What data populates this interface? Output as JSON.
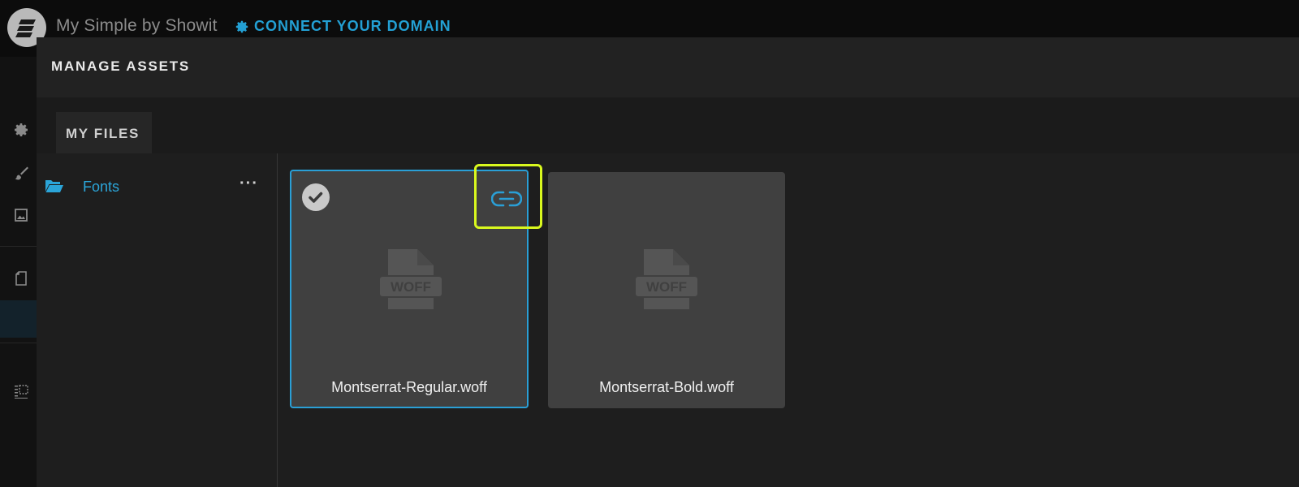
{
  "app": {
    "site_title": "My Simple by Showit",
    "connect_label": "CONNECT YOUR DOMAIN"
  },
  "modal": {
    "title": "MANAGE ASSETS",
    "tabs": [
      {
        "label": "MY FILES"
      }
    ]
  },
  "sidebar": {
    "folders": [
      {
        "label": "Fonts",
        "more": "···"
      }
    ]
  },
  "files": [
    {
      "name": "Montserrat-Regular.woff",
      "type": "WOFF",
      "selected": true
    },
    {
      "name": "Montserrat-Bold.woff",
      "type": "WOFF",
      "selected": false
    }
  ],
  "colors": {
    "accent": "#2a9fd6",
    "highlight": "#d9f81e",
    "card_bg": "#404040"
  },
  "icons": {
    "logo": "showit-logo-icon",
    "connect": "gear-icon",
    "folder": "folder-open-icon",
    "link": "link-icon",
    "check": "check-icon",
    "file": "woff-file-icon"
  }
}
